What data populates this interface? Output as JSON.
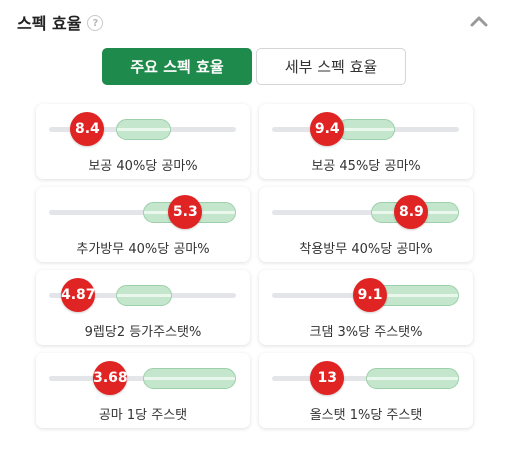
{
  "header": {
    "title": "스펙 효율",
    "help_glyph": "?",
    "collapse_icon": "chevron-up-icon"
  },
  "toggle": {
    "primary_label": "주요 스펙 효율",
    "secondary_label": "세부 스펙 효율",
    "active": "primary"
  },
  "colors": {
    "accent_green": "#1e8a4c",
    "knob_red": "#e02323",
    "range_green": "#c4e6cc"
  },
  "stats": [
    {
      "value": "8.4",
      "label": "보공 40%당 공마%",
      "knob_level": 0.14,
      "range": [
        0.36,
        0.65
      ]
    },
    {
      "value": "9.4",
      "label": "보공 45%당 공마%",
      "knob_level": 0.25,
      "range": [
        0.35,
        0.66
      ]
    },
    {
      "value": "5.3",
      "label": "추가방무 40%당 공마%",
      "knob_level": 0.78,
      "range": [
        0.5,
        1.0
      ]
    },
    {
      "value": "8.9",
      "label": "착용방무 40%당 공마%",
      "knob_level": 0.8,
      "range": [
        0.53,
        1.0
      ]
    },
    {
      "value": "4.87",
      "label": "9렙당2 등가주스탯%",
      "knob_level": 0.08,
      "range": [
        0.36,
        0.66
      ]
    },
    {
      "value": "9.1",
      "label": "크댐 3%당 주스탯%",
      "knob_level": 0.53,
      "range": [
        0.53,
        1.0
      ]
    },
    {
      "value": "3.68",
      "label": "공마 1당 주스탯",
      "knob_level": 0.29,
      "range": [
        0.5,
        1.0
      ]
    },
    {
      "value": "13",
      "label": "올스탯 1%당 주스탯",
      "knob_level": 0.25,
      "range": [
        0.5,
        1.0
      ]
    }
  ]
}
